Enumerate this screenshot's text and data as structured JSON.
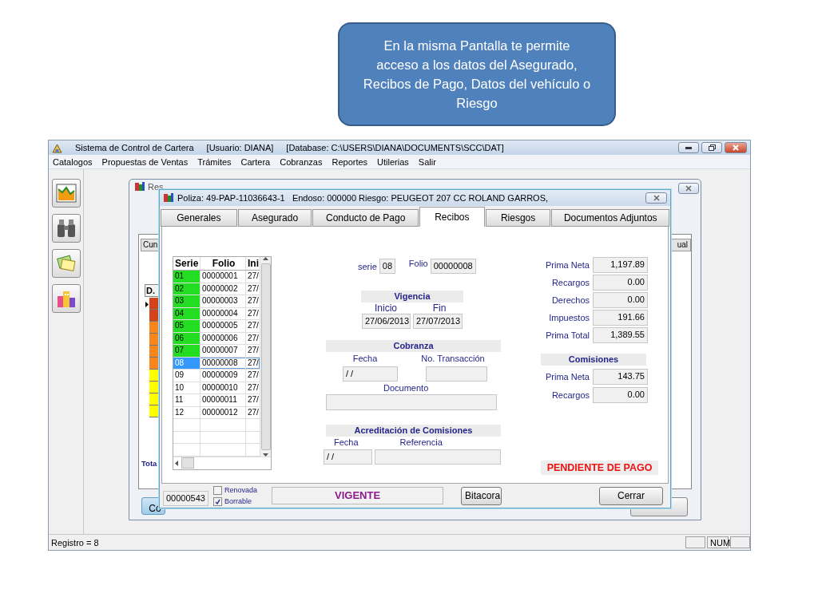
{
  "callout": {
    "text": "En la misma Pantalla te permite acceso a los datos del Asegurado, Recibos de Pago, Datos del vehículo o Riesgo"
  },
  "app": {
    "title_parts": [
      "Sistema de Control de Cartera",
      "[Usuario: DIANA]",
      "[Database: C:\\USERS\\DIANA\\DOCUMENTS\\SCC\\DAT]"
    ],
    "menu": [
      "Catalogos",
      "Propuestas de Ventas",
      "Trámites",
      "Cartera",
      "Cobranzas",
      "Reportes",
      "Utilerias",
      "Salir"
    ],
    "toolbar": [
      {
        "kind": "chart"
      },
      {
        "kind": "binoculars"
      },
      {
        "kind": "papers"
      },
      {
        "kind": "buildings"
      }
    ],
    "status_bar": {
      "text": "Registro = 8",
      "indicator": "NUM"
    }
  },
  "background_window": {
    "title": "Res",
    "tabs": [
      "Cun",
      "ual"
    ],
    "grid_header": "D.",
    "grid_rows": [
      {
        "color": "#d4431a"
      },
      {
        "color": "#d4431a"
      },
      {
        "color": "#f7861c"
      },
      {
        "color": "#f7861c"
      },
      {
        "color": "#f7861c"
      },
      {
        "color": "#f7861c"
      },
      {
        "color": "#ffff00"
      },
      {
        "color": "#ffff00"
      },
      {
        "color": "#ffff00"
      },
      {
        "color": "#ffff00"
      }
    ],
    "total_label": "Tota",
    "button": "Co"
  },
  "dialog": {
    "title": "Poliza: 49-PAP-11036643-1   Endoso: 000000 Riesgo: PEUGEOT 207 CC ROLAND GARROS,",
    "tabs": [
      {
        "label": "Generales",
        "selected": false
      },
      {
        "label": "Asegurado",
        "selected": false
      },
      {
        "label": "Conducto de Pago",
        "selected": false
      },
      {
        "label": "Recibos",
        "selected": true
      },
      {
        "label": "Riesgos",
        "selected": false
      },
      {
        "label": "Documentos Adjuntos",
        "selected": false
      }
    ],
    "receipts": {
      "columns": [
        "Serie",
        "Folio",
        "Ini"
      ],
      "rows": [
        {
          "serie": "01",
          "folio": "00000001",
          "inicio": "27/",
          "color": "#22dd22",
          "selected": false
        },
        {
          "serie": "02",
          "folio": "00000002",
          "inicio": "27/",
          "color": "#22dd22",
          "selected": false
        },
        {
          "serie": "03",
          "folio": "00000003",
          "inicio": "27/",
          "color": "#22dd22",
          "selected": false
        },
        {
          "serie": "04",
          "folio": "00000004",
          "inicio": "27/",
          "color": "#22dd22",
          "selected": false
        },
        {
          "serie": "05",
          "folio": "00000005",
          "inicio": "27/",
          "color": "#22dd22",
          "selected": false
        },
        {
          "serie": "06",
          "folio": "00000006",
          "inicio": "27/",
          "color": "#22dd22",
          "selected": false
        },
        {
          "serie": "07",
          "folio": "00000007",
          "inicio": "27/",
          "color": "#22dd22",
          "selected": false
        },
        {
          "serie": "08",
          "folio": "00000008",
          "inicio": "27/",
          "selected": true
        },
        {
          "serie": "09",
          "folio": "00000009",
          "inicio": "27/",
          "selected": false
        },
        {
          "serie": "10",
          "folio": "00000010",
          "inicio": "27/",
          "selected": false
        },
        {
          "serie": "11",
          "folio": "00000011",
          "inicio": "27/",
          "selected": false
        },
        {
          "serie": "12",
          "folio": "00000012",
          "inicio": "27/",
          "selected": false
        }
      ]
    },
    "serie": {
      "label": "serie",
      "value": "08"
    },
    "folio": {
      "label": "Folio",
      "value": "00000008"
    },
    "vigencia": {
      "title": "Vigencia",
      "inicio_label": "Inicio",
      "fin_label": "Fin",
      "inicio": "27/06/2013",
      "fin": "27/07/2013"
    },
    "cobranza": {
      "title": "Cobranza",
      "fecha_label": "Fecha",
      "transaccion_label": "No. Transacción",
      "fecha": "/ /",
      "documento_label": "Documento"
    },
    "acreditacion": {
      "title": "Acreditación de Comisiones",
      "fecha_label": "Fecha",
      "referencia_label": "Referencia",
      "fecha": "/ /"
    },
    "amounts": [
      {
        "label": "Prima Neta",
        "value": "1,197.89"
      },
      {
        "label": "Recargos",
        "value": "0.00"
      },
      {
        "label": "Derechos",
        "value": "0.00"
      },
      {
        "label": "Impuestos",
        "value": "191.66"
      },
      {
        "label": "Prima Total",
        "value": "1,389.55"
      }
    ],
    "comisiones": {
      "title": "Comisiones",
      "amounts": [
        {
          "label": "Prima Neta",
          "value": "143.75"
        },
        {
          "label": "Recargos",
          "value": "0.00"
        }
      ]
    },
    "payment_status": "PENDIENTE DE PAGO",
    "number": "00000543",
    "checkboxes": [
      {
        "label": "Renovada",
        "checked": false
      },
      {
        "label": "Borrable",
        "checked": true
      }
    ],
    "state": "VIGENTE",
    "buttons": [
      "Bitacora",
      "Cerrar"
    ]
  }
}
